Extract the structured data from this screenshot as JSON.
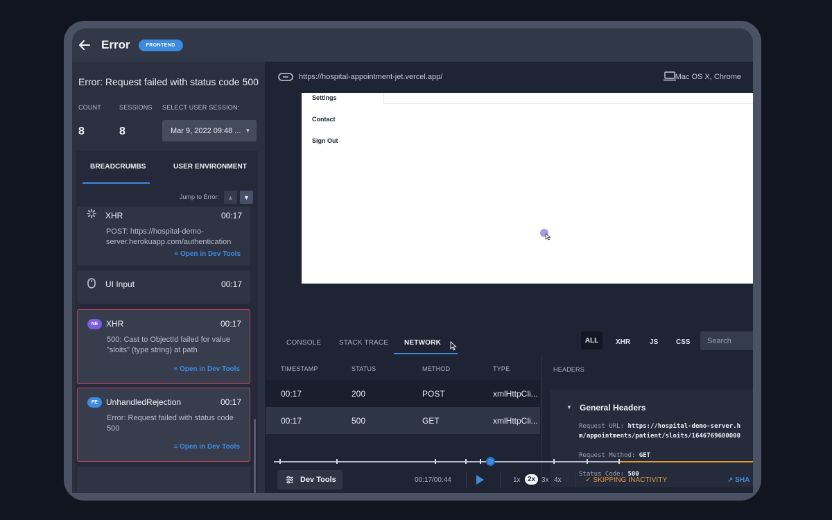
{
  "header": {
    "title": "Error",
    "badge": "FRONTEND"
  },
  "error": {
    "title": "Error: Request failed with status code 500",
    "count_label": "COUNT",
    "count": "8",
    "sessions_label": "SESSIONS",
    "sessions": "8",
    "select_label": "SELECT USER SESSION:",
    "session_value": "Mar 9, 2022 09:48 ..."
  },
  "tabs": {
    "breadcrumbs": "BREADCRUMBS",
    "environment": "USER ENVIRONMENT"
  },
  "jump_label": "Jump to Error:",
  "breadcrumbs": [
    {
      "name": "XHR",
      "time": "00:17",
      "desc": "POST: https://hospital-demo-server.herokuapp.com/authentication",
      "link": "Open in Dev Tools"
    },
    {
      "name": "UI Input",
      "time": "00:17"
    },
    {
      "pill": "NE",
      "name": "XHR",
      "time": "00:17",
      "desc": "500: Cast to ObjectId failed for value \"sloits\" (type string) at path",
      "link": "Open in Dev Tools"
    },
    {
      "pill": "FE",
      "name": "UnhandledRejection",
      "time": "00:17",
      "desc": "Error: Request failed with status code 500",
      "link": "Open in Dev Tools"
    }
  ],
  "browser": {
    "url": "https://hospital-appointment-jet.vercel.app/",
    "env": "Mac OS X, Chrome",
    "menu": [
      "Settings",
      "Contact",
      "Sign Out"
    ]
  },
  "devtools": {
    "tabs": [
      "CONSOLE",
      "STACK TRACE",
      "NETWORK"
    ],
    "filters": [
      "ALL",
      "XHR",
      "JS",
      "CSS"
    ],
    "search_placeholder": "Search",
    "columns": [
      "TIMESTAMP",
      "STATUS",
      "METHOD",
      "TYPE"
    ],
    "rows": [
      {
        "timestamp": "00:17",
        "status": "200",
        "method": "POST",
        "type": "xmlHttpCli..."
      },
      {
        "timestamp": "00:17",
        "status": "500",
        "method": "GET",
        "type": "xmlHttpCli..."
      }
    ],
    "headers_label": "HEADERS",
    "general_headers": "General Headers",
    "request_url_label": "Request URL:",
    "request_url_value": "https://hospital-demo-server.h",
    "request_url_cont": "m/appointments/patient/sloits/1646769600000",
    "method_label": "Request Method:",
    "method_value": "GET",
    "status_label": "Status Code:",
    "status_value": "500"
  },
  "player": {
    "devtools_label": "Dev Tools",
    "time": "00:17/00:44",
    "speeds": [
      "1x",
      "2x",
      "3x",
      "4x"
    ],
    "skip_label": "SKIPPING INACTIVITY",
    "share_label": "SHA",
    "progress": 0.45
  },
  "colors": {
    "accent": "#3d8be0",
    "error_border": "#c2415e",
    "warning": "#e09a3b",
    "pill_ne": "#7b5ce0",
    "pill_fe": "#3d8be0"
  }
}
